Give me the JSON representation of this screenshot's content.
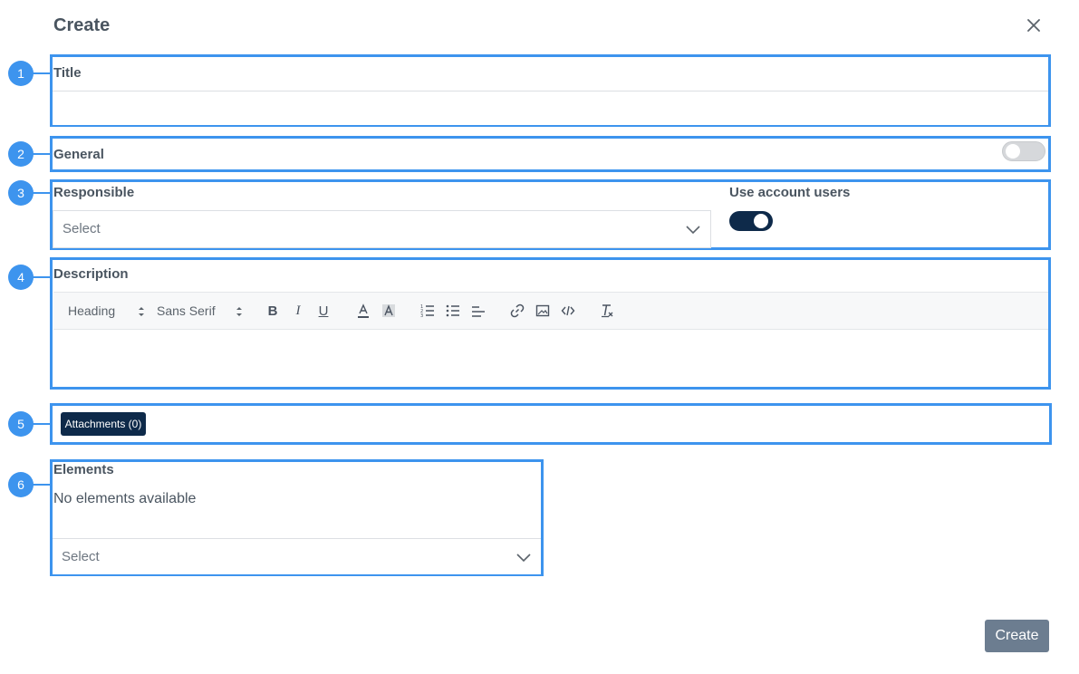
{
  "modal": {
    "title": "Create",
    "close_icon": "close-icon"
  },
  "annotations": [
    "1",
    "2",
    "3",
    "4",
    "5",
    "6"
  ],
  "title_section": {
    "label": "Title",
    "value": ""
  },
  "general_section": {
    "label": "General",
    "toggle_on": false
  },
  "responsible_section": {
    "label": "Responsible",
    "select_value": "Select",
    "use_account_users_label": "Use account users",
    "use_account_users_on": true
  },
  "description_section": {
    "label": "Description",
    "toolbar": {
      "heading_select": "Heading",
      "font_select": "Sans Serif",
      "tools": [
        "bold-icon",
        "italic-icon",
        "underline-icon",
        "text-color-icon",
        "background-color-icon",
        "ordered-list-icon",
        "bullet-list-icon",
        "align-icon",
        "link-icon",
        "image-icon",
        "code-icon",
        "clear-format-icon"
      ]
    },
    "value": ""
  },
  "attachments": {
    "button_label": "Attachments (0)"
  },
  "elements_section": {
    "label": "Elements",
    "empty_text": "No elements available",
    "select_value": "Select"
  },
  "footer": {
    "create_label": "Create"
  },
  "colors": {
    "highlight": "#3d94ee",
    "primary_dark": "#0e2a4a",
    "create_button": "#6c7d90"
  }
}
